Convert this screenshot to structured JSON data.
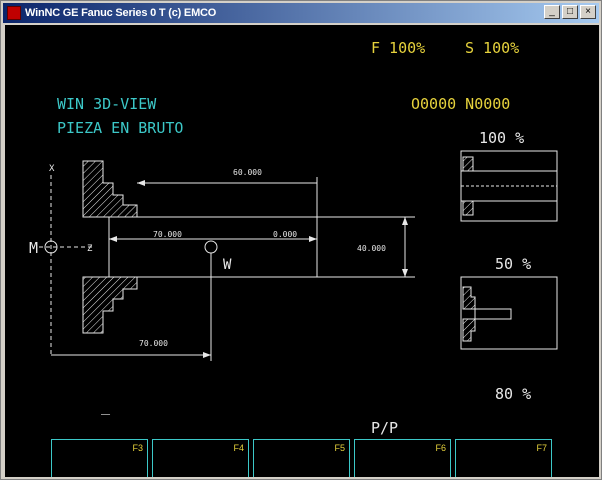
{
  "window": {
    "title": "WinNC GE Fanuc Series 0 T (c) EMCO",
    "controls": [
      "_",
      "□",
      "×"
    ]
  },
  "status": {
    "feed": "F 100%",
    "spindle": "S 100%",
    "program": "O0000 N0000"
  },
  "view": {
    "mode": "WIN 3D-VIEW",
    "subtitle": "PIEZA EN BRUTO",
    "zoom_top": "100 %",
    "zoom_mid": "50 %",
    "zoom_bottom": "80 %"
  },
  "drawing": {
    "axis_x_label": "X",
    "axis_z_label": "Z",
    "machine_zero": "M",
    "workpiece_zero": "W",
    "dim_length": "60.000",
    "dim_overhang": "70.000",
    "dim_face": "0.000",
    "dim_diameter": "40.000",
    "dim_total": "70.000"
  },
  "footer": {
    "cursor": "_",
    "page": "P/P",
    "softkeys": [
      "F3",
      "F4",
      "F5",
      "F6",
      "F7"
    ]
  },
  "colors": {
    "background": "#000000",
    "yellow_text": "#e6d23c",
    "cyan_text": "#3cc8c8",
    "drawing_lines": "#e8e8e8"
  }
}
